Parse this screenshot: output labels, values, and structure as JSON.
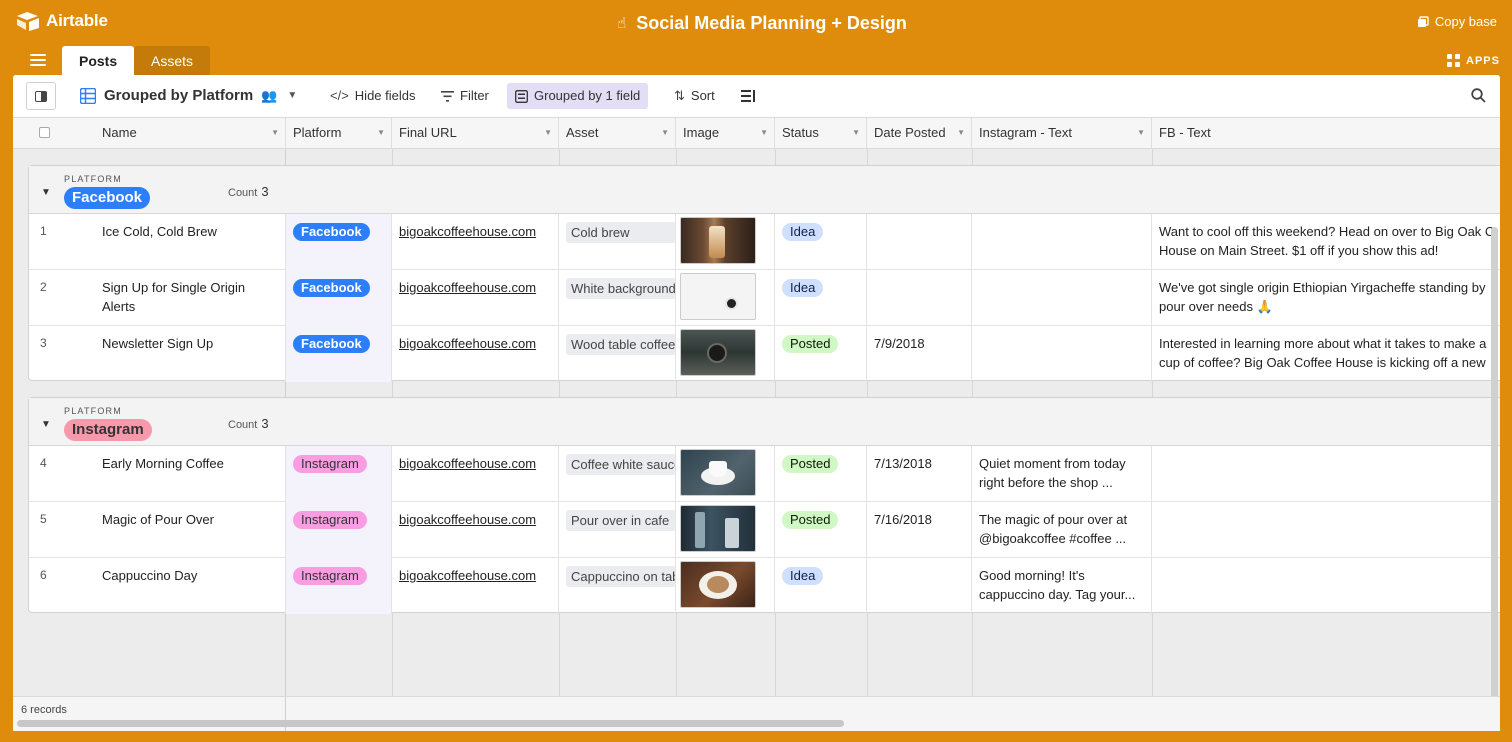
{
  "app": {
    "name": "Airtable",
    "base_title": "Social Media Planning + Design",
    "copy_base_label": "Copy base",
    "apps_label": "APPS"
  },
  "tabs": [
    {
      "label": "Posts",
      "active": true
    },
    {
      "label": "Assets",
      "active": false
    }
  ],
  "toolbar": {
    "view_name": "Grouped by Platform",
    "hide_fields": "Hide fields",
    "filter": "Filter",
    "grouped": "Grouped by 1 field",
    "sort": "Sort"
  },
  "columns": [
    "Name",
    "Platform",
    "Final URL",
    "Asset",
    "Image",
    "Status",
    "Date Posted",
    "Instagram - Text",
    "FB - Text"
  ],
  "groups": [
    {
      "label": "PLATFORM",
      "value": "Facebook",
      "count_label": "Count",
      "count": "3",
      "color": "#2d7ff9",
      "rows": [
        {
          "num": "1",
          "name": "Ice Cold, Cold Brew",
          "platform": "Facebook",
          "url": "bigoakcoffeehouse.com",
          "asset": "Cold brew",
          "image": "cold-brew-photo",
          "status": "Idea",
          "date": "",
          "ig_text": "",
          "fb_text_1": "Want to cool off this weekend? Head on over to Big Oak C",
          "fb_text_2": "House on Main Street. $1 off if you show this ad!"
        },
        {
          "num": "2",
          "name": "Sign Up for Single Origin Alerts",
          "platform": "Facebook",
          "url": "bigoakcoffeehouse.com",
          "asset": "White background",
          "image": "white-background-photo",
          "status": "Idea",
          "date": "",
          "ig_text": "",
          "fb_text_1": "We've got single origin Ethiopian Yirgacheffe standing by",
          "fb_text_2": "pour over needs 🙏"
        },
        {
          "num": "3",
          "name": "Newsletter Sign Up",
          "platform": "Facebook",
          "url": "bigoakcoffeehouse.com",
          "asset": "Wood table coffee",
          "image": "wood-table-photo",
          "status": "Posted",
          "date": "7/9/2018",
          "ig_text": "",
          "fb_text_1": "Interested in learning more about what it takes to make a",
          "fb_text_2": "cup of coffee? Big Oak Coffee House is kicking off a new"
        }
      ]
    },
    {
      "label": "PLATFORM",
      "value": "Instagram",
      "count_label": "Count",
      "count": "3",
      "color": "#f799ab",
      "rows": [
        {
          "num": "4",
          "name": "Early Morning Coffee",
          "platform": "Instagram",
          "url": "bigoakcoffeehouse.com",
          "asset": "Coffee white saucer",
          "image": "coffee-saucer-photo",
          "status": "Posted",
          "date": "7/13/2018",
          "ig_text": "Quiet moment from today right before the shop ...",
          "fb_text_1": "",
          "fb_text_2": ""
        },
        {
          "num": "5",
          "name": "Magic of Pour Over",
          "platform": "Instagram",
          "url": "bigoakcoffeehouse.com",
          "asset": "Pour over in cafe",
          "image": "pour-over-photo",
          "status": "Posted",
          "date": "7/16/2018",
          "ig_text": "The magic of pour over at @bigoakcoffee #coffee ...",
          "fb_text_1": "",
          "fb_text_2": ""
        },
        {
          "num": "6",
          "name": "Cappuccino Day",
          "platform": "Instagram",
          "url": "bigoakcoffeehouse.com",
          "asset": "Cappuccino on table",
          "image": "cappuccino-photo",
          "status": "Idea",
          "date": "",
          "ig_text": "Good morning! It's cappuccino day. Tag your...",
          "fb_text_1": "",
          "fb_text_2": ""
        }
      ]
    }
  ],
  "footer": {
    "records": "6 records"
  },
  "colors": {
    "brand": "#df8c0c",
    "facebook": "#2d7ff9",
    "instagram_pill": "#f99de2",
    "idea": "#cfdfff",
    "posted": "#d1f7c4",
    "toolbar_active": "#e3ddf6"
  }
}
